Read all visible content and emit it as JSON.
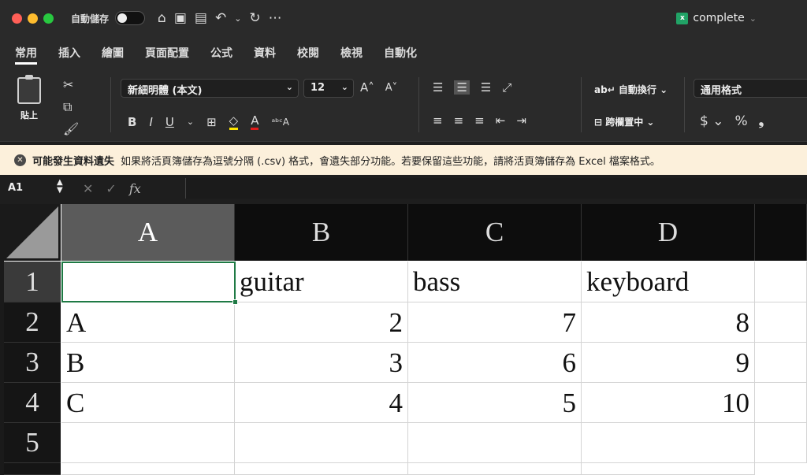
{
  "window": {
    "autosave_label": "自動儲存",
    "document_name": "complete",
    "toolbar_icons": [
      "home-icon",
      "save-icon",
      "save-as-icon",
      "undo-icon",
      "redo-icon",
      "more-icon"
    ]
  },
  "ribbon_tabs": [
    {
      "label": "常用"
    },
    {
      "label": "插入"
    },
    {
      "label": "繪圖"
    },
    {
      "label": "頁面配置"
    },
    {
      "label": "公式"
    },
    {
      "label": "資料"
    },
    {
      "label": "校閱"
    },
    {
      "label": "檢視"
    },
    {
      "label": "自動化"
    }
  ],
  "ribbon": {
    "paste_label": "貼上",
    "font_name": "新細明體 (本文)",
    "font_size": "12",
    "wrap_text_label": "自動換行",
    "merge_center_label": "跨欄置中",
    "number_format": "通用格式"
  },
  "notice": {
    "title": "可能發生資料遺失",
    "message": "如果將活頁簿儲存為逗號分隔 (.csv) 格式，會遺失部分功能。若要保留這些功能，請將活頁簿儲存為 Excel 檔案格式。"
  },
  "formula_bar": {
    "name_box": "A1",
    "fx_label": "fx",
    "content": ""
  },
  "sheet": {
    "columns": [
      "A",
      "B",
      "C",
      "D"
    ],
    "rows": [
      "1",
      "2",
      "3",
      "4",
      "5"
    ],
    "cells": [
      [
        "",
        "guitar",
        "bass",
        "keyboard"
      ],
      [
        "A",
        "2",
        "7",
        "8"
      ],
      [
        "B",
        "3",
        "6",
        "9"
      ],
      [
        "C",
        "4",
        "5",
        "10"
      ],
      [
        "",
        "",
        "",
        ""
      ]
    ],
    "selected_cell": "A1"
  },
  "colors": {
    "accent_green": "#1f7a45",
    "notice_bg": "#fcf0db",
    "ribbon_bg": "#2a2a2a"
  }
}
